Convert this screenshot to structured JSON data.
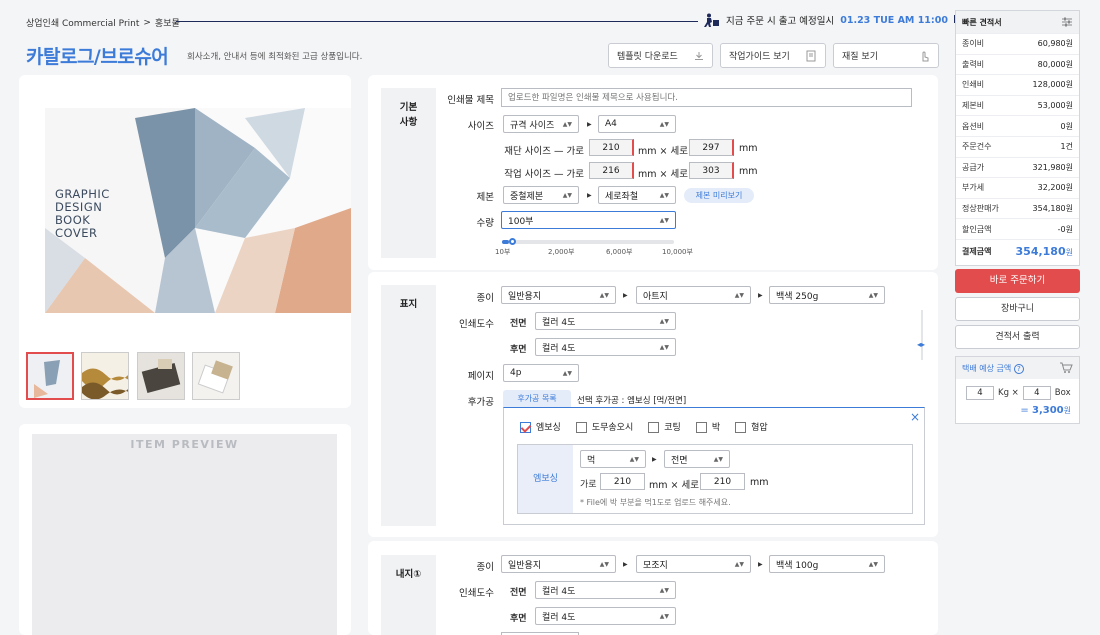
{
  "breadcrumb": {
    "root": "상업인쇄 Commercial Print",
    "sep": ">",
    "current": "홍보물"
  },
  "shipping": {
    "text": "지금 주문 시 출고 예정일시",
    "datetime": "01.23 TUE AM 11:00"
  },
  "page": {
    "title": "카탈로그/브로슈어",
    "subtitle": "회사소개, 안내서 등에 최적화된 고급 상품입니다."
  },
  "top_buttons": {
    "template": "템플릿 다운로드",
    "guide": "작업가이드 보기",
    "material": "재질 보기"
  },
  "preview": {
    "cover_lines": [
      "GRAPHIC",
      "DESIGN",
      "BOOK",
      "COVER"
    ],
    "item_preview": "ITEM PREVIEW",
    "thumbnails": 4
  },
  "basic": {
    "section": "기본\n사항",
    "title_label": "인쇄물 제목",
    "title_placeholder": "업로드한 파일명은 인쇄물 제목으로 사용됩니다.",
    "size_label": "사이즈",
    "size_type": "규격 사이즈",
    "size_value": "A4",
    "cut_label": "재단 사이즈 — 가로",
    "cut_w": "210",
    "cut_h": "297",
    "work_label": "작업 사이즈 — 가로",
    "work_w": "216",
    "work_h": "303",
    "mm_x": "mm × 세로",
    "mm": "mm",
    "binding_label": "제본",
    "binding_type": "중철제본",
    "binding_dir": "세로좌철",
    "binding_preview": "제본 미리보기",
    "qty_label": "수량",
    "qty_value": "100부",
    "slider_ticks": [
      "10부",
      "2,000부",
      "6,000부",
      "10,000부"
    ],
    "slider_level": 0.02
  },
  "cover": {
    "section": "표지",
    "paper_label": "종이",
    "paper_type": "일반용지",
    "paper_kind": "아트지",
    "paper_weight": "백색 250g",
    "color_label": "인쇄도수",
    "front": "전면",
    "front_value": "컬러 4도",
    "back": "후면",
    "back_value": "컬러 4도",
    "page_label": "페이지",
    "page_value": "4p",
    "post_label": "후가공",
    "post_tab": "후가공 목록",
    "post_selected": "선택 후가공 : 엠보싱 [먹/전면]",
    "post_options": [
      {
        "label": "엠보싱",
        "checked": true
      },
      {
        "label": "도무송오시",
        "checked": false
      },
      {
        "label": "코팅",
        "checked": false
      },
      {
        "label": "박",
        "checked": false
      },
      {
        "label": "형압",
        "checked": false
      }
    ],
    "emboss": {
      "label": "엠보싱",
      "color": "먹",
      "side": "전면",
      "w_label": "가로",
      "w": "210",
      "x_label": "mm × 세로",
      "h": "210",
      "mm": "mm",
      "note": "* File에 박 부분을 먹1도로 업로드 해주세요."
    }
  },
  "inner": {
    "section": "내지①",
    "paper_label": "종이",
    "paper_type": "일반용지",
    "paper_kind": "모조지",
    "paper_weight": "백색 100g",
    "color_label": "인쇄도수",
    "front": "전면",
    "front_value": "컬러 4도",
    "back": "후면",
    "back_value": "컬러 4도"
  },
  "quote": {
    "title": "빠른 견적서",
    "rows": [
      {
        "k": "종이비",
        "v": "60,980원"
      },
      {
        "k": "출력비",
        "v": "80,000원"
      },
      {
        "k": "인쇄비",
        "v": "128,000원"
      },
      {
        "k": "제본비",
        "v": "53,000원"
      },
      {
        "k": "옵션비",
        "v": "0원"
      },
      {
        "k": "주문건수",
        "v": "1건"
      },
      {
        "k": "공급가",
        "v": "321,980원"
      },
      {
        "k": "부가세",
        "v": "32,200원"
      },
      {
        "k": "정상판매가",
        "v": "354,180원"
      },
      {
        "k": "할인금액",
        "v": "-0원"
      }
    ],
    "total_label": "결제금액",
    "total_value": "354,180",
    "total_unit": "원",
    "order_btn": "바로 주문하기",
    "cart_btn": "장바구니",
    "print_btn": "견적서 출력"
  },
  "delivery": {
    "title": "택배 예상 금액",
    "kg": "4",
    "kg_unit": "Kg ×",
    "box": "4",
    "box_unit": "Box",
    "price_prefix": "= ",
    "price": "3,300",
    "price_unit": "원"
  },
  "colors": {
    "accent": "#3d7bd8",
    "navy": "#1e2a5a",
    "red": "#e24c4c"
  }
}
